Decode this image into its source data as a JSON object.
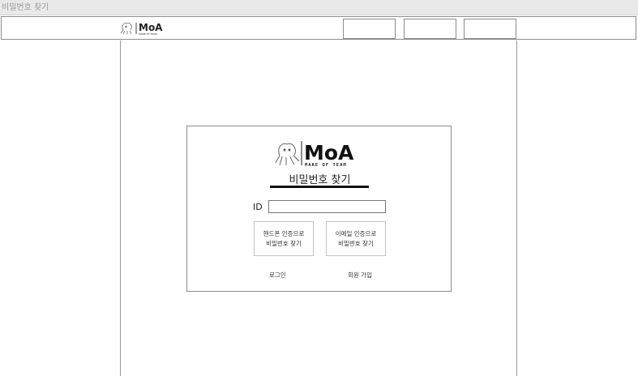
{
  "window": {
    "title": "비밀번호 찾기"
  },
  "header": {
    "logo": {
      "text": "MoA",
      "sub": "MAKE OF TEAM"
    },
    "nav_buttons": [
      "",
      "",
      ""
    ]
  },
  "card": {
    "logo": {
      "text": "MoA",
      "sub": "MAKE OF TEAM"
    },
    "title": "비밀번호 찾기",
    "id_label": "ID",
    "id_value": "",
    "phone_button": {
      "line1": "핸드폰 인증으로",
      "line2": "비밀번호 찾기"
    },
    "email_button": {
      "line1": "이메일 인증으로",
      "line2": "비밀번호 찾기"
    },
    "login_link": "로그인",
    "signup_link": "회원 가입"
  }
}
